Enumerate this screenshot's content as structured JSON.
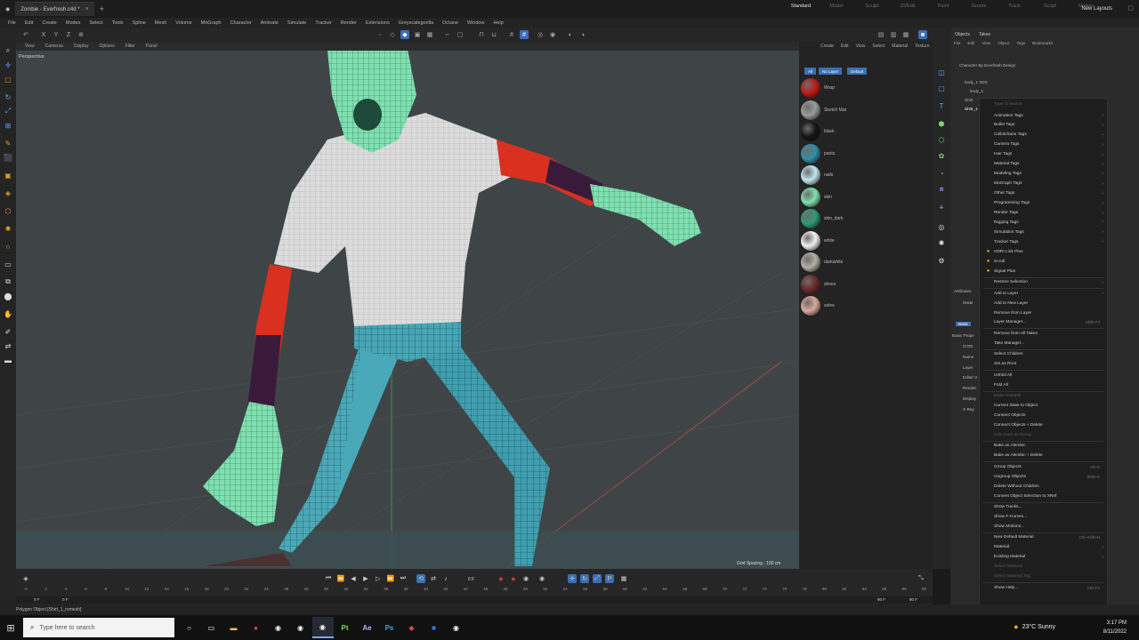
{
  "window": {
    "tab_title": "Zombie - Everfresh.c4d *",
    "layout_tabs": [
      "Standard",
      "Model",
      "Sculpt",
      "UVEdit",
      "Paint",
      "Groom",
      "Track",
      "Script",
      "Nodes"
    ],
    "active_layout": "Standard",
    "new_layouts": "New Layouts"
  },
  "menubar": [
    "File",
    "Edit",
    "Create",
    "Modes",
    "Select",
    "Tools",
    "Spline",
    "Mesh",
    "Volume",
    "MoGraph",
    "Character",
    "Animate",
    "Simulate",
    "Tracker",
    "Render",
    "Extensions",
    "Greyscalegorilla",
    "Octane",
    "Window",
    "Help"
  ],
  "viewport": {
    "menu": [
      "View",
      "Cameras",
      "Display",
      "Options",
      "Filter",
      "Panel"
    ],
    "label": "Perspective",
    "grid_spacing": "Grid Spacing : 100 cm"
  },
  "materials": {
    "menu": [
      "Create",
      "Edit",
      "View",
      "Select",
      "Material",
      "Texture"
    ],
    "filters": [
      "All",
      "No Layer",
      "Default"
    ],
    "items": [
      {
        "name": "Wrap",
        "color": "#c21818"
      },
      {
        "name": "Sketch Mat",
        "color": "#9a9a9a"
      },
      {
        "name": "black",
        "color": "#151515"
      },
      {
        "name": "pants",
        "color": "#2f8fa8"
      },
      {
        "name": "nails",
        "color": "#bfe6ee"
      },
      {
        "name": "skin",
        "color": "#7fe0b0"
      },
      {
        "name": "skin_dark",
        "color": "#2f9a76"
      },
      {
        "name": "white",
        "color": "#f2f2f2"
      },
      {
        "name": "darkwhite",
        "color": "#b0b0a4"
      },
      {
        "name": "shoes",
        "color": "#6a2a2a"
      },
      {
        "name": "soles",
        "color": "#d9a89a"
      }
    ]
  },
  "objects": {
    "tabs": [
      "Objects",
      "Takes"
    ],
    "menu": [
      "File",
      "Edit",
      "View",
      "Object",
      "Tags",
      "Bookmarks"
    ],
    "rows": [
      "Character By Everfresh Design",
      "body_1 SDS",
      "body_1",
      "Shirt",
      "Shirt_1"
    ],
    "attributes_label": "Attributes",
    "mode_label": "Mode",
    "basic_label": "Basic",
    "basic_props": "Basic Prope",
    "prop_rows": [
      "ICON",
      "Name",
      "Layer",
      "Editor V",
      "Render",
      "Display",
      "X-Ray"
    ]
  },
  "context_menu": {
    "search_placeholder": "Type to search",
    "items": [
      {
        "label": "Animation Tags",
        "arrow": true
      },
      {
        "label": "Bullet Tags",
        "arrow": true
      },
      {
        "label": "Cellotchane Tags",
        "arrow": true
      },
      {
        "label": "Camera Tags",
        "arrow": true
      },
      {
        "label": "Hair Tags",
        "arrow": true
      },
      {
        "label": "Material Tags",
        "arrow": true
      },
      {
        "label": "Modeling Tags",
        "arrow": true
      },
      {
        "label": "MoGraph Tags",
        "arrow": true
      },
      {
        "label": "Other Tags",
        "arrow": true
      },
      {
        "label": "Programming Tags",
        "arrow": true
      },
      {
        "label": "Render Tags",
        "arrow": true
      },
      {
        "label": "Rigging Tags",
        "arrow": true
      },
      {
        "label": "Simulation Tags",
        "arrow": true
      },
      {
        "label": "Tracker Tags",
        "arrow": true
      },
      {
        "label": "HDRI Link Plus",
        "icon": "hdri-icon"
      },
      {
        "label": "Scroll",
        "icon": "scroll-icon"
      },
      {
        "label": "Signal Plus",
        "icon": "signal-icon"
      },
      {
        "label": "Restore Selection",
        "arrow": true,
        "sep": true
      },
      {
        "label": "Add to Layer",
        "arrow": true,
        "sep": true
      },
      {
        "label": "Add to New Layer"
      },
      {
        "label": "Remove from Layer"
      },
      {
        "label": "Layer Manager...",
        "shortcut": "Shift+F4"
      },
      {
        "label": "Remove from All Takes",
        "sep": true
      },
      {
        "label": "Take Manager..."
      },
      {
        "label": "Select Children",
        "sep": true
      },
      {
        "label": "Set as Root"
      },
      {
        "label": "Unfold All",
        "sep": true
      },
      {
        "label": "Fold All"
      },
      {
        "label": "Make Editable",
        "disabled": true,
        "sep": true
      },
      {
        "label": "Current State to Object"
      },
      {
        "label": "Connect Objects"
      },
      {
        "label": "Connect Objects + Delete"
      },
      {
        "label": "Edit Asset as Group",
        "disabled": true
      },
      {
        "label": "Bake as Alembic",
        "sep": true
      },
      {
        "label": "Bake as Alembic + Delete"
      },
      {
        "label": "Group Objects",
        "shortcut": "Alt+G",
        "sep": true
      },
      {
        "label": "Ungroup Objects",
        "shortcut": "Shift+G"
      },
      {
        "label": "Delete Without Children"
      },
      {
        "label": "Convert Object Selection to XRef"
      },
      {
        "label": "Show Tracks...",
        "sep": true
      },
      {
        "label": "Show F-Curves..."
      },
      {
        "label": "Show Motions..."
      },
      {
        "label": "New Default Material",
        "shortcut": "Ctrl+Shift+N",
        "sep": true
      },
      {
        "label": "Material",
        "arrow": true
      },
      {
        "label": "Existing Material",
        "arrow": true
      },
      {
        "label": "Select Material",
        "disabled": true
      },
      {
        "label": "Select Material Tag",
        "disabled": true
      },
      {
        "label": "Show Help...",
        "shortcut": "Ctrl+F1",
        "sep": true
      }
    ]
  },
  "timeline": {
    "current_frame": "0 F",
    "ticks": [
      "0",
      "2",
      "4",
      "6",
      "8",
      "10",
      "12",
      "14",
      "16",
      "18",
      "20",
      "22",
      "24",
      "26",
      "28",
      "30",
      "32",
      "34",
      "36",
      "38",
      "40",
      "42",
      "44",
      "46",
      "48",
      "50",
      "52",
      "54",
      "56",
      "58",
      "60",
      "62",
      "64",
      "66",
      "68",
      "70",
      "72",
      "74",
      "76",
      "78",
      "80",
      "82",
      "84",
      "86",
      "88",
      "90"
    ],
    "start_frame": "0 F",
    "min_frame": "0 F",
    "end_frame": "90 F",
    "max_frame": "90 F"
  },
  "status": "Polygon Object [Shirt_1_remesh]",
  "taskbar": {
    "search_placeholder": "Type here to search",
    "weather": "23°C  Sunny",
    "time": "3:17 PM",
    "date": "8/11/2022",
    "apps": [
      {
        "name": "cortana-icon",
        "glyph": "○",
        "color": "#ffffff"
      },
      {
        "name": "task-view-icon",
        "glyph": "▭",
        "color": "#ffffff"
      },
      {
        "name": "file-explorer-icon",
        "glyph": "▬",
        "color": "#f2c14e"
      },
      {
        "name": "chrome-icon",
        "glyph": "●",
        "color": "#e8453c"
      },
      {
        "name": "cinema4d-icon",
        "glyph": "◉",
        "color": "#ffffff"
      },
      {
        "name": "cinema4d-alt-icon",
        "glyph": "◉",
        "color": "#ffffff"
      },
      {
        "name": "cinema4d-active-icon",
        "glyph": "◉",
        "color": "#ffffff"
      },
      {
        "name": "substance-painter-icon",
        "glyph": "Pt",
        "color": "#7ed957"
      },
      {
        "name": "after-effects-icon",
        "glyph": "Ae",
        "color": "#c7a6ff"
      },
      {
        "name": "photoshop-icon",
        "glyph": "Ps",
        "color": "#31a8ff"
      },
      {
        "name": "redshift-icon",
        "glyph": "◆",
        "color": "#e0493b"
      },
      {
        "name": "folder-icon",
        "glyph": "■",
        "color": "#2f7fe0"
      },
      {
        "name": "cinema4d-extra-icon",
        "glyph": "◉",
        "color": "#ffffff"
      }
    ]
  }
}
